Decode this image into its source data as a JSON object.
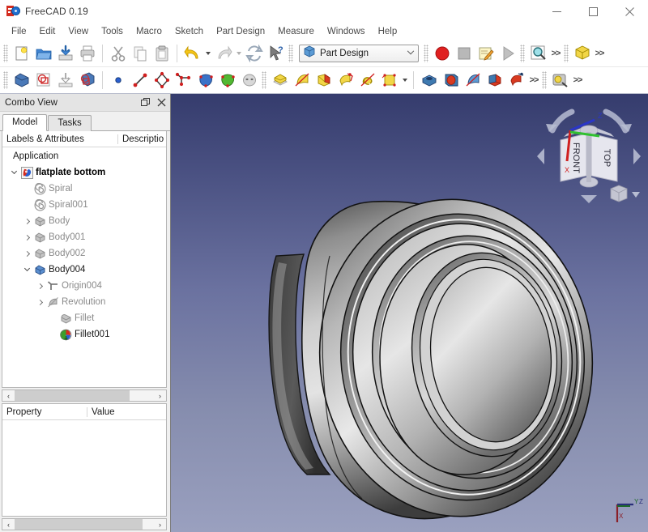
{
  "window": {
    "title": "FreeCAD 0.19",
    "app_icon": "freecad-logo-icon",
    "controls": {
      "minimize": "minimize-icon",
      "maximize": "maximize-icon",
      "close": "close-icon"
    }
  },
  "menubar": {
    "items": [
      {
        "label": "File"
      },
      {
        "label": "Edit"
      },
      {
        "label": "View"
      },
      {
        "label": "Tools"
      },
      {
        "label": "Macro"
      },
      {
        "label": "Sketch"
      },
      {
        "label": "Part Design"
      },
      {
        "label": "Measure"
      },
      {
        "label": "Windows"
      },
      {
        "label": "Help"
      }
    ]
  },
  "toolbars": {
    "row1": {
      "file_group": [
        {
          "name": "new-document-button",
          "tooltip": "New"
        },
        {
          "name": "open-document-button",
          "tooltip": "Open"
        },
        {
          "name": "save-document-button",
          "tooltip": "Save"
        },
        {
          "name": "print-document-button",
          "tooltip": "Print"
        }
      ],
      "edit_group": [
        {
          "name": "cut-button",
          "tooltip": "Cut"
        },
        {
          "name": "copy-button",
          "tooltip": "Copy"
        },
        {
          "name": "paste-button",
          "tooltip": "Paste"
        }
      ],
      "undo_group": [
        {
          "name": "undo-button",
          "tooltip": "Undo"
        },
        {
          "name": "redo-button",
          "tooltip": "Redo"
        },
        {
          "name": "refresh-button",
          "tooltip": "Refresh"
        },
        {
          "name": "whats-this-button",
          "tooltip": "What's This?"
        }
      ],
      "workbench": {
        "selected": "Part Design",
        "icon": "part-design-workbench-icon"
      },
      "macro_group": [
        {
          "name": "macro-record-button",
          "tooltip": "Macro recording"
        },
        {
          "name": "macro-stop-button",
          "tooltip": "Stop macro recording"
        },
        {
          "name": "macros-button",
          "tooltip": "Macros"
        },
        {
          "name": "execute-macro-button",
          "tooltip": "Execute macro"
        }
      ],
      "view_group": [
        {
          "name": "fit-all-button",
          "tooltip": "Fits the whole content on the screen"
        }
      ],
      "structure_group": [
        {
          "name": "create-part-button",
          "tooltip": "Create part"
        }
      ],
      "overflow": ">>"
    },
    "row2": {
      "part_group": [
        {
          "name": "create-body-button",
          "tooltip": "Create body"
        },
        {
          "name": "create-sketch-button",
          "tooltip": "Create sketch"
        },
        {
          "name": "attach-sketch-button",
          "tooltip": "Attach sketch"
        },
        {
          "name": "validate-sketch-button",
          "tooltip": "Validate sketch"
        }
      ],
      "datum_group": [
        {
          "name": "create-datum-point-button",
          "tooltip": "Create a datum point"
        },
        {
          "name": "create-datum-line-button",
          "tooltip": "Create a datum line"
        },
        {
          "name": "create-datum-plane-button",
          "tooltip": "Create a datum plane"
        },
        {
          "name": "create-local-coordinate-system-button",
          "tooltip": "Create a local coordinate system"
        },
        {
          "name": "create-shapebinder-button",
          "tooltip": "Create a shape binder"
        },
        {
          "name": "create-subobject-shapebinder-button",
          "tooltip": "Create a sub-object shape binder"
        },
        {
          "name": "create-clone-button",
          "tooltip": "Create a clone"
        }
      ],
      "additive_group": [
        {
          "name": "pad-button",
          "tooltip": "Pad"
        },
        {
          "name": "revolution-button",
          "tooltip": "Revolution"
        },
        {
          "name": "additive-loft-button",
          "tooltip": "Additive loft"
        },
        {
          "name": "additive-pipe-button",
          "tooltip": "Additive pipe"
        },
        {
          "name": "additive-helix-button",
          "tooltip": "Additive helix"
        },
        {
          "name": "additive-primitive-button",
          "tooltip": "Create an additive primitive"
        }
      ],
      "subtractive_group": [
        {
          "name": "pocket-button",
          "tooltip": "Pocket"
        },
        {
          "name": "hole-button",
          "tooltip": "Hole"
        },
        {
          "name": "groove-button",
          "tooltip": "Groove"
        },
        {
          "name": "subtractive-loft-button",
          "tooltip": "Subtractive loft"
        },
        {
          "name": "subtractive-pipe-button",
          "tooltip": "Subtractive pipe"
        }
      ],
      "measure_group": [
        {
          "name": "measure-button",
          "tooltip": "Measure"
        }
      ],
      "overflow": ">>"
    }
  },
  "combo_view": {
    "title": "Combo View",
    "float_button": "float-panel-icon",
    "close_button": "close-panel-icon",
    "tabs": [
      {
        "label": "Model",
        "active": true
      },
      {
        "label": "Tasks",
        "active": false
      }
    ],
    "tree": {
      "columns": [
        "Labels & Attributes",
        "Descriptio"
      ],
      "rows": [
        {
          "label": "Application",
          "indent": 0,
          "expander": "none",
          "icon": "none",
          "style": "dark"
        },
        {
          "label": "flatplate bottom",
          "indent": 1,
          "expander": "down",
          "icon": "document-icon",
          "style": "bold"
        },
        {
          "label": "Spiral",
          "indent": 2,
          "expander": "none",
          "icon": "spiral-icon",
          "style": "grey"
        },
        {
          "label": "Spiral001",
          "indent": 2,
          "expander": "none",
          "icon": "spiral-icon",
          "style": "grey"
        },
        {
          "label": "Body",
          "indent": 2,
          "expander": "right",
          "icon": "body-icon",
          "style": "grey"
        },
        {
          "label": "Body001",
          "indent": 2,
          "expander": "right",
          "icon": "body-icon",
          "style": "grey"
        },
        {
          "label": "Body002",
          "indent": 2,
          "expander": "right",
          "icon": "body-icon",
          "style": "grey"
        },
        {
          "label": "Body004",
          "indent": 2,
          "expander": "down",
          "icon": "body-active-icon",
          "style": "dark"
        },
        {
          "label": "Origin004",
          "indent": 3,
          "expander": "right",
          "icon": "origin-icon",
          "style": "grey"
        },
        {
          "label": "Revolution",
          "indent": 3,
          "expander": "right",
          "icon": "revolution-icon",
          "style": "grey"
        },
        {
          "label": "Fillet",
          "indent": 3,
          "expander": "none",
          "icon": "fillet-icon",
          "style": "grey"
        },
        {
          "label": "Fillet001",
          "indent": 3,
          "expander": "none",
          "icon": "fillet-tip-icon",
          "style": "dark"
        }
      ]
    },
    "property_editor": {
      "columns": [
        "Property",
        "Value"
      ],
      "rows": []
    },
    "scrollbars": {
      "tree_horizontal": "tree-hscrollbar",
      "property_horizontal": "property-hscrollbar",
      "left_arrow": "‹",
      "right_arrow": "›"
    }
  },
  "viewport": {
    "name": "3d-viewport",
    "background_top": "#353c6d",
    "background_bottom": "#9aa0bf",
    "model_description": "grey shaded revolved cylindrical flat-plate part",
    "navigation_cube": {
      "front_face": "FRONT",
      "top_face": "TOP",
      "axis_labels": {
        "x": "X",
        "y": "Y",
        "z": "Z"
      },
      "arrows": [
        "rotate-left-arrow",
        "rotate-right-arrow",
        "pan-left-arrow",
        "pan-right-arrow",
        "pan-up-arrow",
        "pan-down-arrow"
      ],
      "corner_cube": "view-corner-cube-icon",
      "corner_menu": "view-menu-chevron-icon"
    },
    "axis_cross": {
      "x": "X",
      "y": "Y",
      "z": "Z"
    }
  },
  "colors": {
    "accent_blue": "#1f6fd0",
    "logo_red": "#d42b1e",
    "toolbar_yellow": "#f2d647",
    "toolbar_red": "#cc2222",
    "model_grey": "#b0b0b0"
  }
}
